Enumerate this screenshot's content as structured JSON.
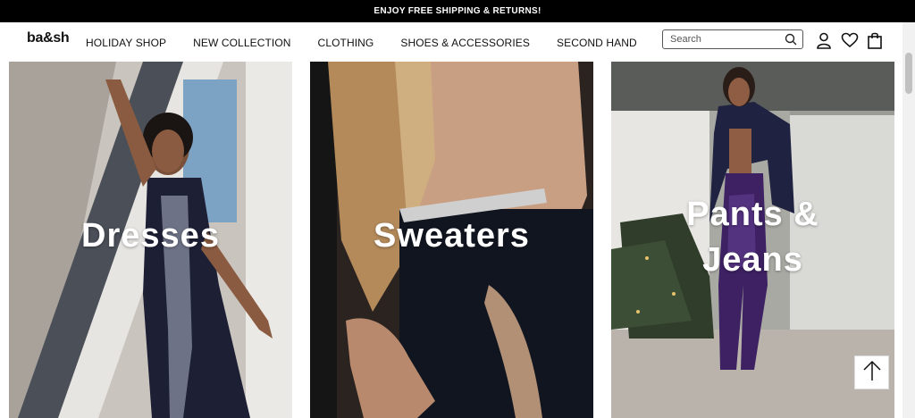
{
  "promo": {
    "text": "ENJOY FREE SHIPPING & RETURNS!"
  },
  "header": {
    "logo": "ba&sh",
    "nav": [
      "HOLIDAY SHOP",
      "NEW COLLECTION",
      "CLOTHING",
      "SHOES & ACCESSORIES",
      "SECOND HAND"
    ],
    "search_placeholder": "Search",
    "icons": [
      "search-icon",
      "account-icon",
      "wishlist-heart-icon",
      "shopping-bag-icon"
    ]
  },
  "tiles": [
    {
      "label": "Dresses"
    },
    {
      "label": "Sweaters"
    },
    {
      "label_line1": "Pants &",
      "label_line2": "Jeans"
    }
  ],
  "back_to_top": {
    "icon": "arrow-up-icon"
  },
  "colors": {
    "promo_bg": "#000000",
    "text": "#111111",
    "background": "#ffffff"
  }
}
